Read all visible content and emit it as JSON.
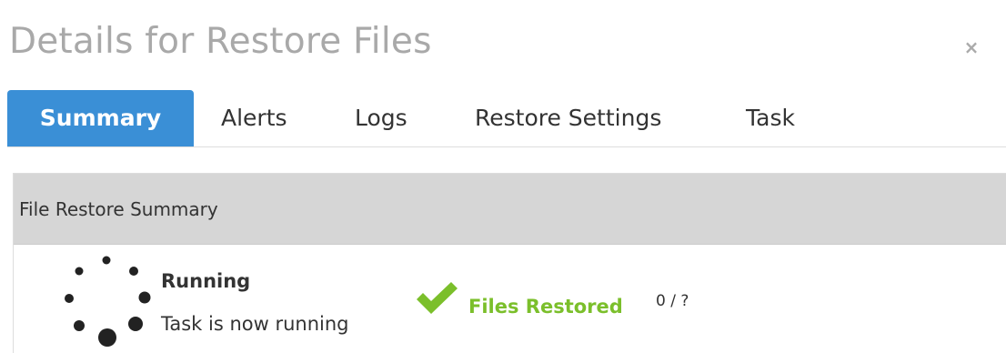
{
  "dialog": {
    "title": "Details for Restore Files",
    "close_label": "×"
  },
  "tabs": [
    {
      "label": "Summary",
      "active": true
    },
    {
      "label": "Alerts",
      "active": false
    },
    {
      "label": "Logs",
      "active": false
    },
    {
      "label": "Restore Settings",
      "active": false
    },
    {
      "label": "Task",
      "active": false
    }
  ],
  "panel": {
    "heading": "File Restore Summary"
  },
  "status": {
    "title": "Running",
    "subtitle": "Task is now running",
    "icon": "spinner-icon"
  },
  "files": {
    "label": "Files Restored",
    "count": "0 / ?",
    "icon": "checkmark-icon"
  },
  "colors": {
    "title_text": "#a9a9a9",
    "close_icon": "#aaaaaa",
    "tab_active_bg": "#3a8fd6",
    "tab_active_text": "#ffffff",
    "panel_heading_bg": "#d6d6d6",
    "success": "#7bbf2b",
    "spinner": "#222222"
  }
}
